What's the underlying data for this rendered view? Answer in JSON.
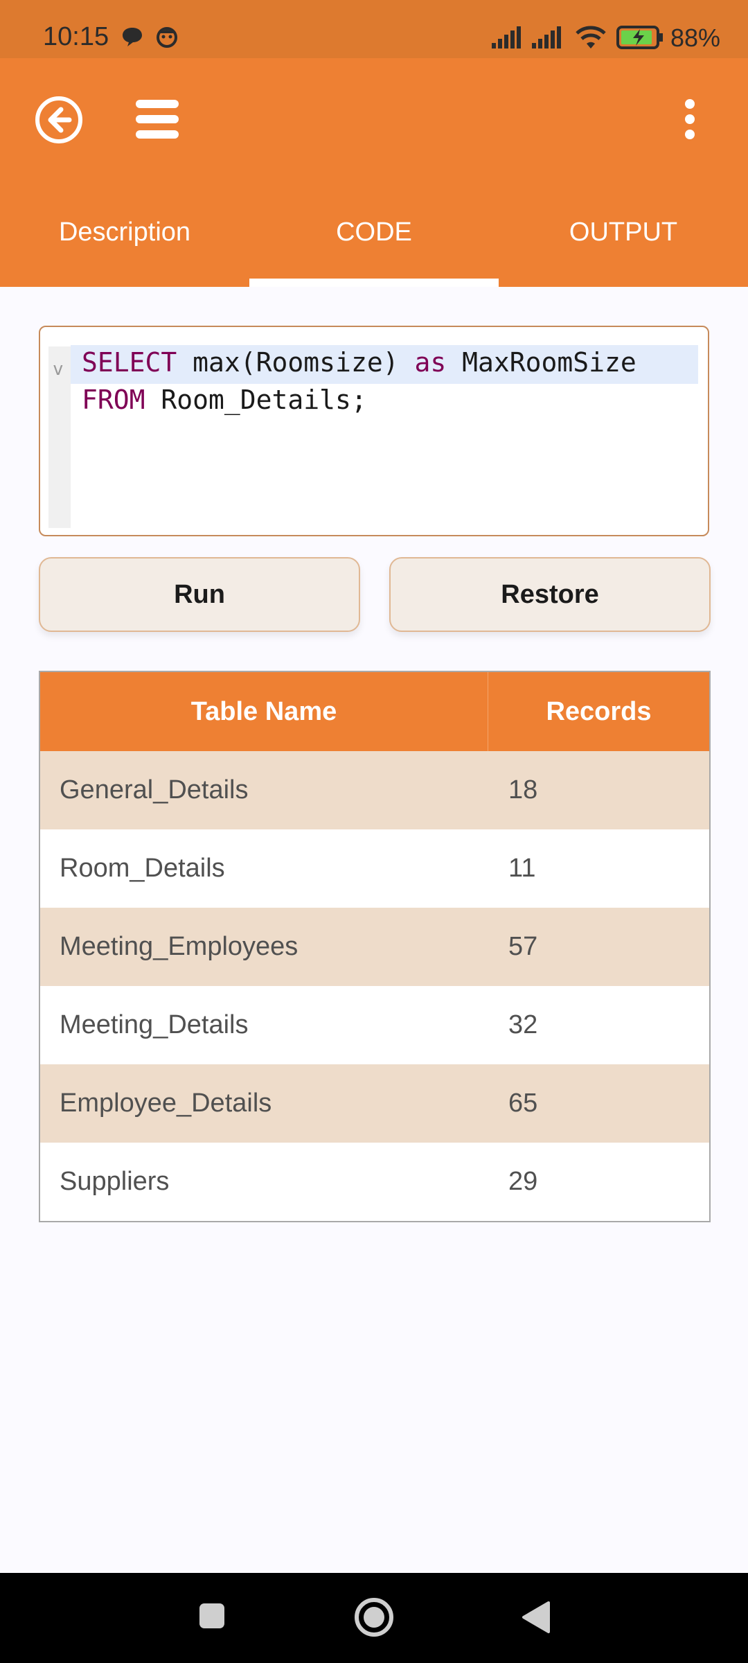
{
  "status_bar": {
    "time": "10:15",
    "battery": "88%"
  },
  "tabs": [
    {
      "label": "Description"
    },
    {
      "label": "CODE"
    },
    {
      "label": "OUTPUT"
    }
  ],
  "selected_tab": "CODE",
  "editor": {
    "line1": {
      "kw1": "SELECT",
      "t1": " max(Roomsize) ",
      "kw2": "as",
      "t2": " MaxRoomSize"
    },
    "line2": {
      "kw1": "FROM",
      "t1": " Room_Details;"
    }
  },
  "buttons": {
    "run": "Run",
    "restore": "Restore"
  },
  "table": {
    "headers": [
      "Table Name",
      "Records"
    ],
    "rows": [
      [
        "General_Details",
        "18"
      ],
      [
        "Room_Details",
        "11"
      ],
      [
        "Meeting_Employees",
        "57"
      ],
      [
        "Meeting_Details",
        "32"
      ],
      [
        "Employee_Details",
        "65"
      ],
      [
        "Suppliers",
        "29"
      ]
    ]
  },
  "colors": {
    "accent": "#ee8033",
    "statusbar": "#dd7a2f",
    "row_alt": "#eedcca",
    "keyword": "#7f0055"
  }
}
